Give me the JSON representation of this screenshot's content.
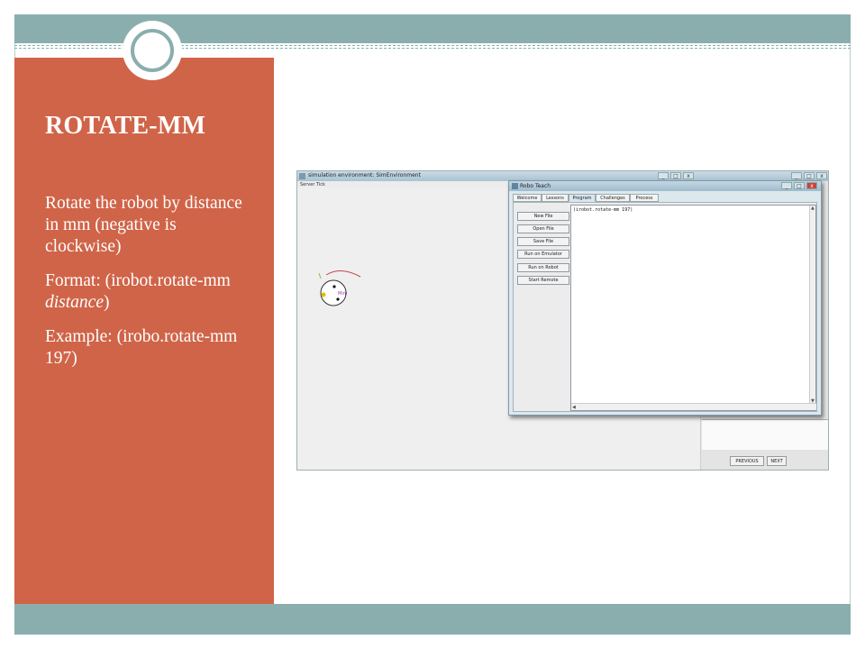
{
  "slide": {
    "title": "ROTATE-MM",
    "paragraphs": [
      "Rotate the robot by distance in mm (negative is clockwise)",
      {
        "prefix": "Format: (irobot.rotate-mm ",
        "italic": "distance",
        "suffix": ")"
      },
      "Example: (irobo.rotate-mm 197)"
    ]
  },
  "colors": {
    "accent_red": "#d06448",
    "band_teal": "#8aaeae",
    "background": "#ffffff"
  },
  "screenshot": {
    "sim_window": {
      "title": "simulation environment: SimEnvironment",
      "menu": "Server  Tick",
      "buttons": [
        "_",
        "□",
        "x"
      ],
      "nav_buttons": [
        "PREVIOUS",
        "NEXT"
      ]
    },
    "robot_label": "Mini",
    "robo_teach": {
      "title": "Robo Teach",
      "window_buttons": [
        "_",
        "□",
        "x"
      ],
      "tabs": [
        "Welcome",
        "Lessons",
        "Program",
        "Challenges",
        "Process"
      ],
      "active_tab": "Program",
      "side_buttons": [
        "New File",
        "Open File",
        "Save File",
        "Run on Emulator",
        "Run on Robot",
        "Start Remote"
      ],
      "code": "(irobot.rotate-mm 197)",
      "scroll_up": "▲",
      "scroll_down": "▼",
      "scroll_left": "◀"
    }
  }
}
